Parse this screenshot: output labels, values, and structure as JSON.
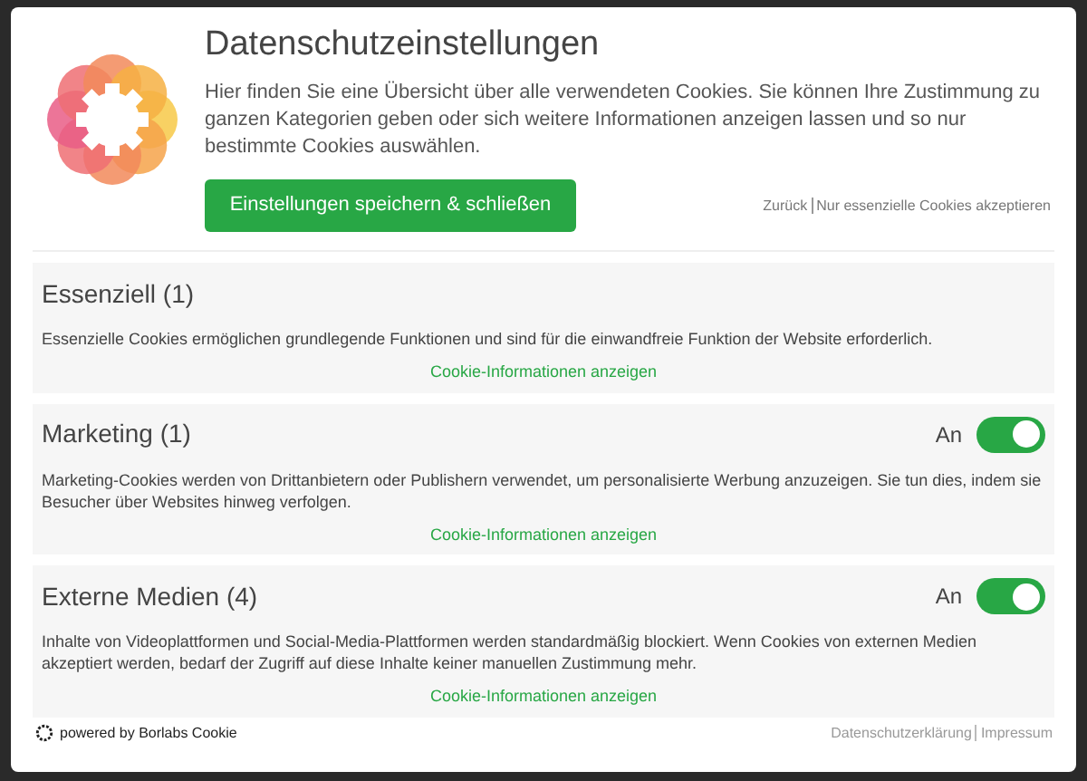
{
  "dialog": {
    "title": "Datenschutzeinstellungen",
    "description": "Hier finden Sie eine Übersicht über alle verwendeten Cookies. Sie können Ihre Zustimmung zu ganzen Kategorien geben oder sich weitere Informationen anzeigen lassen und so nur bestimmte Cookies auswählen.",
    "save_button": "Einstellungen speichern & schließen",
    "links": [
      "Zurück",
      "Nur essenzielle Cookies akzeptieren"
    ]
  },
  "categories": [
    {
      "title": "Essenziell (1)",
      "description": "Essenzielle Cookies ermöglichen grundlegende Funktionen und sind für die einwandfreie Funktion der Website erforderlich.",
      "info_link": "Cookie-Informationen anzeigen"
    },
    {
      "title": "Marketing (1)",
      "switch": {
        "label": "An",
        "on": true
      },
      "description": "Marketing-Cookies werden von Drittanbietern oder Publishern verwendet, um personalisierte Werbung anzuzeigen. Sie tun dies, indem sie Besucher über Websites hinweg verfolgen.",
      "info_link": "Cookie-Informationen anzeigen"
    },
    {
      "title": "Externe Medien (4)",
      "switch": {
        "label": "An",
        "on": true
      },
      "description": "Inhalte von Videoplattformen und Social-Media-Plattformen werden standardmäßig blockiert. Wenn Cookies von externen Medien akzeptiert werden, bedarf der Zugriff auf diese Inhalte keiner manuellen Zustimmung mehr.",
      "info_link": "Cookie-Informationen anzeigen"
    }
  ],
  "footer": {
    "powered_by": "powered by Borlabs Cookie",
    "links": [
      "Datenschutzerklärung",
      "Impressum"
    ]
  }
}
